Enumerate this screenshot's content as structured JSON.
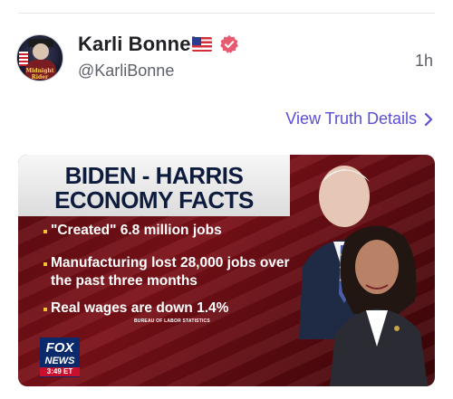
{
  "post": {
    "display_name": "Karli Bonne’",
    "handle": "@KarliBonne",
    "timestamp": "1h",
    "view_details_label": "View Truth Details",
    "avatar_text": "Midnight Rider"
  },
  "media": {
    "headline_line1": "BIDEN - HARRIS",
    "headline_line2": "ECONOMY FACTS",
    "bullets": [
      "\"Created\" 6.8 million jobs",
      "Manufacturing lost 28,000 jobs over the past three months",
      "Real wages are down 1.4%"
    ],
    "source": "BUREAU OF LABOR STATISTICS",
    "network_line1": "FOX",
    "network_line2": "NEWS",
    "broadcast_time": "3:49 ET"
  },
  "colors": {
    "link": "#5a4fd6",
    "verified": "#e85a6f",
    "background": "#ffffff"
  },
  "icons": [
    "flag-us-icon",
    "verified-badge-icon",
    "chevron-right-icon",
    "fox-news-logo-icon"
  ]
}
